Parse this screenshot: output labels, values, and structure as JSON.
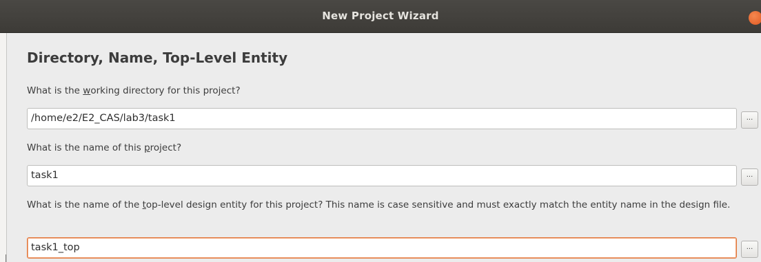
{
  "window": {
    "title": "New Project Wizard"
  },
  "page": {
    "heading": "Directory, Name, Top-Level Entity"
  },
  "fields": {
    "directory": {
      "label_before": "What is the ",
      "label_mnemonic": "w",
      "label_after": "orking directory for this project?",
      "value": "/home/e2/E2_CAS/lab3/task1",
      "browse_label": "..."
    },
    "project_name": {
      "label_before": "What is the name of this ",
      "label_mnemonic": "p",
      "label_after": "roject?",
      "value": "task1",
      "browse_label": "..."
    },
    "top_level_entity": {
      "label_before": "What is the name of the ",
      "label_mnemonic": "t",
      "label_after": "op-level design entity for this project? This name is case sensitive and must exactly match the entity name in the design file.",
      "value": "task1_top",
      "browse_label": "..."
    }
  },
  "colors": {
    "titlebar": "#3d3b37",
    "close_button": "#e05a22",
    "focus_border": "#e2793f"
  }
}
